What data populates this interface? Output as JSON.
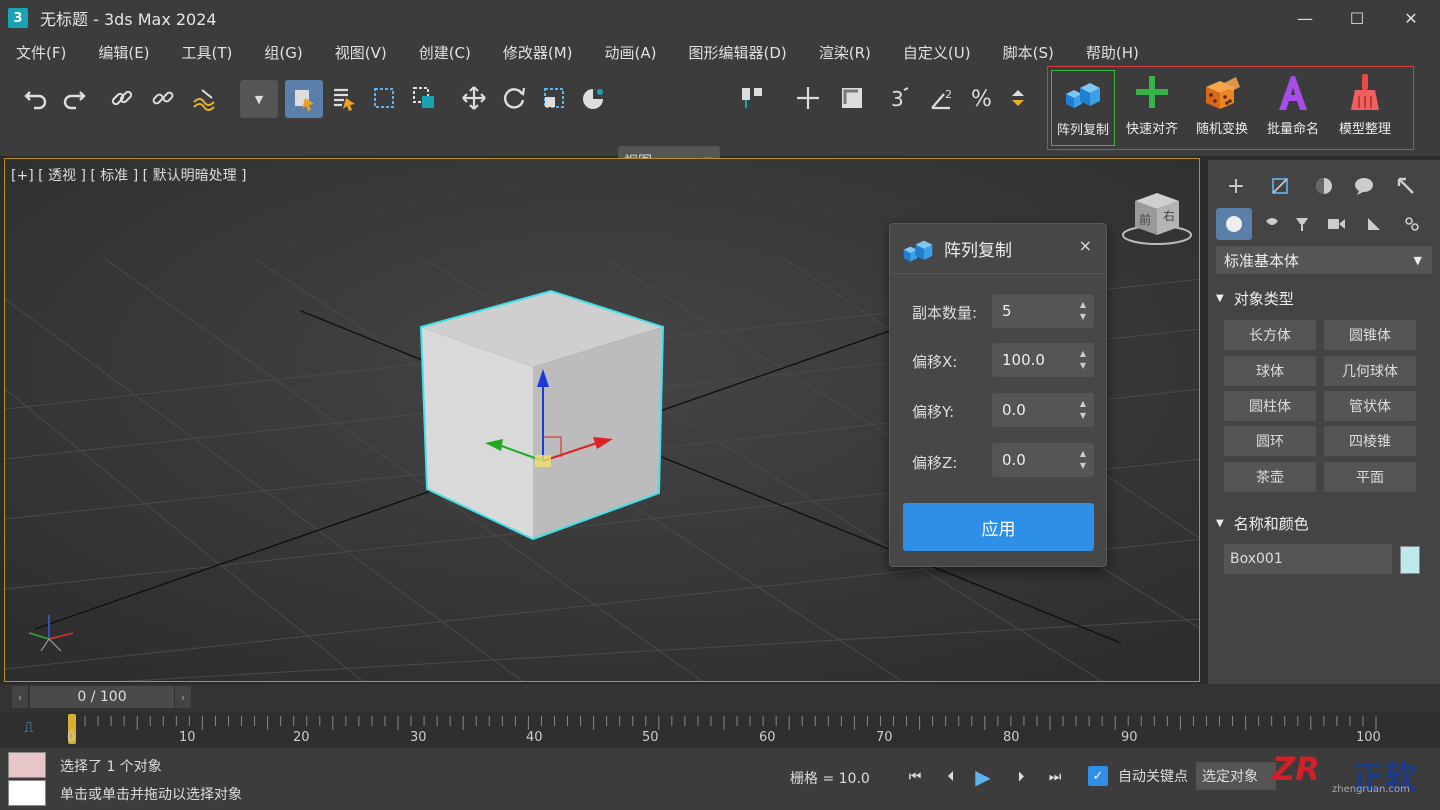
{
  "window": {
    "app_icon": "3",
    "title": "无标题 - 3ds Max 2024",
    "minimize": "—",
    "maximize": "☐",
    "close": "✕"
  },
  "menu": [
    "文件(F)",
    "编辑(E)",
    "工具(T)",
    "组(G)",
    "视图(V)",
    "创建(C)",
    "修改器(M)",
    "动画(A)",
    "图形编辑器(D)",
    "渲染(R)",
    "自定义(U)",
    "脚本(S)",
    "帮助(H)"
  ],
  "toolbar": {
    "view_dropdown": "视图",
    "plugins": [
      {
        "label": "阵列复制",
        "icon": "cube-stack-icon"
      },
      {
        "label": "快速对齐",
        "icon": "green-cross-icon"
      },
      {
        "label": "随机变换",
        "icon": "dice-icon"
      },
      {
        "label": "批量命名",
        "icon": "letter-a-icon"
      },
      {
        "label": "模型整理",
        "icon": "broom-icon"
      }
    ]
  },
  "viewport": {
    "label": "[+] [ 透视 ] [ 标准 ] [ 默认明暗处理 ]",
    "viewcube_front": "前",
    "viewcube_right": "右"
  },
  "dialog": {
    "title": "阵列复制",
    "close": "×",
    "fields": [
      {
        "label": "副本数量:",
        "value": "5"
      },
      {
        "label": "偏移X:",
        "value": "100.0"
      },
      {
        "label": "偏移Y:",
        "value": "0.0"
      },
      {
        "label": "偏移Z:",
        "value": "0.0"
      }
    ],
    "apply": "应用"
  },
  "command_panel": {
    "category": "标准基本体",
    "object_type_header": "对象类型",
    "objects": [
      "长方体",
      "圆锥体",
      "球体",
      "几何球体",
      "圆柱体",
      "管状体",
      "圆环",
      "四棱锥",
      "茶壶",
      "平面"
    ],
    "name_color_header": "名称和颜色",
    "object_name": "Box001",
    "object_color": "#bde8ec"
  },
  "timeline": {
    "frame_display": "0 / 100",
    "ticks": [
      "0",
      "10",
      "20",
      "30",
      "40",
      "50",
      "60",
      "70",
      "80",
      "90",
      "100"
    ]
  },
  "status": {
    "line1": "选择了 1 个对象",
    "line2": "单击或单击并拖动以选择对象",
    "grid": "栅格 = 10.0",
    "auto_key": "自动关键点",
    "selection_set": "选定对象"
  },
  "watermark": {
    "logo": "ZR",
    "text": "正软",
    "site": "zhengruan.com"
  }
}
